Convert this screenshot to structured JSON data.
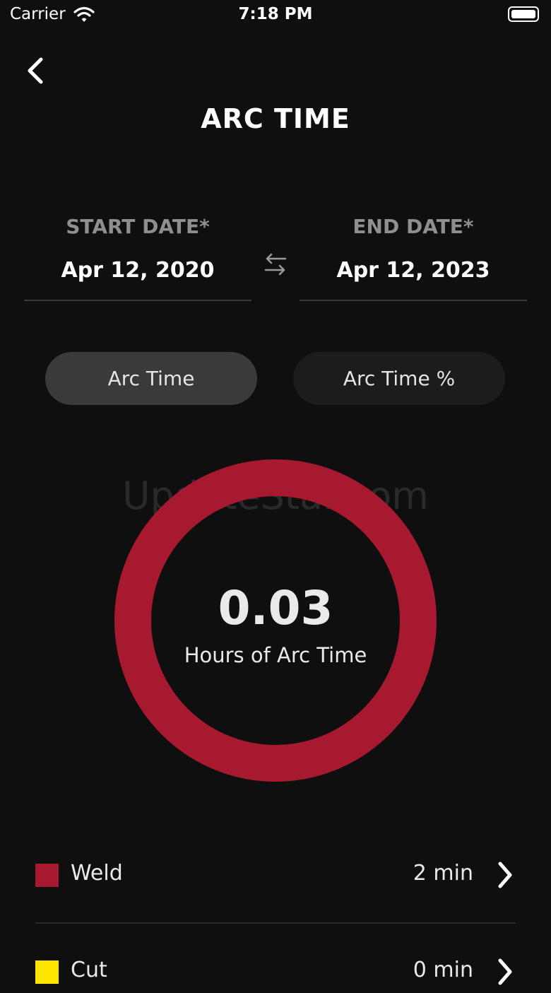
{
  "status_bar": {
    "carrier": "Carrier",
    "time": "7:18 PM"
  },
  "header": {
    "title": "ARC TIME"
  },
  "dates": {
    "start_label": "START DATE*",
    "start_value": "Apr 12, 2020",
    "end_label": "END DATE*",
    "end_value": "Apr 12, 2023"
  },
  "toggle": {
    "options": [
      "Arc Time",
      "Arc Time %"
    ],
    "selected": "Arc Time"
  },
  "watermark": "UpdateStar.com",
  "summary": {
    "value": "0.03",
    "caption": "Hours of Arc Time"
  },
  "legend": [
    {
      "label": "Weld",
      "value": "2 min",
      "color": "#a6192e"
    },
    {
      "label": "Cut",
      "value": "0 min",
      "color": "#ffe600"
    }
  ],
  "chart_data": {
    "type": "pie",
    "categories": [
      "Weld",
      "Cut"
    ],
    "values": [
      2,
      0
    ],
    "colors": [
      "#a6192e",
      "#ffe600"
    ]
  },
  "theme": {
    "background": "#0f0f10",
    "accent": "#a6192e"
  }
}
